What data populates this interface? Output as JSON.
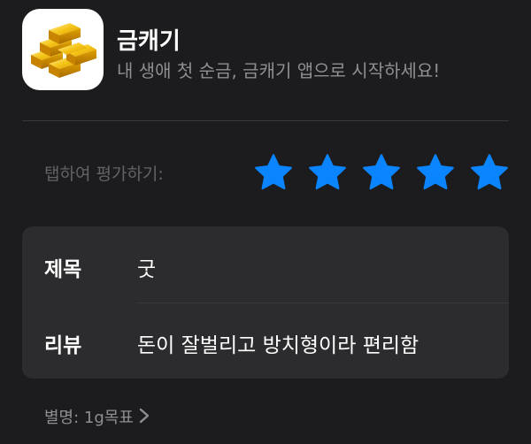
{
  "app": {
    "name": "금캐기",
    "subtitle": "내 생애 첫 순금, 금캐기 앱으로 시작하세요!",
    "icon": "gold-bars-icon"
  },
  "rating": {
    "prompt": "탭하여 평가하기:",
    "stars": 5,
    "max_stars": 5,
    "star_color": "#0a84ff"
  },
  "review": {
    "title_label": "제목",
    "title_value": "굿",
    "body_label": "리뷰",
    "body_value": "돈이 잘벌리고 방치형이라 편리함"
  },
  "nickname": {
    "text": "별명: 1g목표",
    "icon": "chevron-right-icon"
  }
}
